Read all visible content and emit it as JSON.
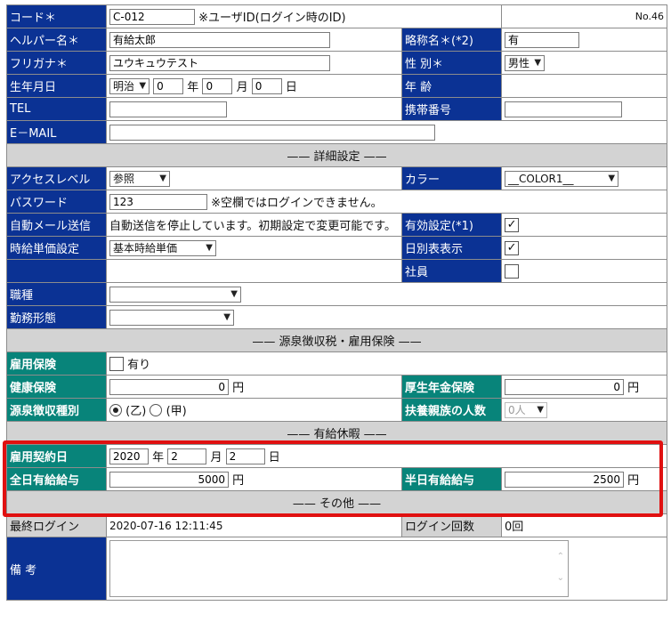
{
  "number_label": "No.46",
  "basic": {
    "code_label": "コード＊",
    "code_value": "C-012",
    "code_note": "※ユーザID(ログイン時のID)",
    "helper_label": "ヘルパー名＊",
    "helper_value": "有給太郎",
    "abbr_label": "略称名＊(*2)",
    "abbr_value": "有",
    "kana_label": "フリガナ＊",
    "kana_value": "ユウキュウテスト",
    "gender_label": "性 別＊",
    "gender_value": "男性",
    "birth_label": "生年月日",
    "era_value": "明治",
    "year_value": "0",
    "year_unit": "年",
    "month_value": "0",
    "month_unit": "月",
    "day_value": "0",
    "day_unit": "日",
    "age_label": "年 齢",
    "tel_label": "TEL",
    "mobile_label": "携帯番号",
    "email_label": "E－MAIL"
  },
  "detail": {
    "header": "—— 詳細設定 ——",
    "access_label": "アクセスレベル",
    "access_value": "参照",
    "color_label": "カラー",
    "color_value": "__COLOR1__",
    "password_label": "パスワード",
    "password_value": "123",
    "password_note": "※空欄ではログインできません。",
    "automail_label": "自動メール送信",
    "automail_value": "自動送信を停止しています。初期設定で変更可能です。",
    "valid_label": "有効設定(*1)",
    "hourly_label": "時給単価設定",
    "hourly_value": "基本時給単価",
    "daily_label": "日別表表示",
    "employee_label": "社員",
    "job_label": "職種",
    "worktype_label": "勤務形態"
  },
  "tax": {
    "header": "—— 源泉徴収税・雇用保険 ——",
    "employment_ins_label": "雇用保険",
    "employment_ins_option": "有り",
    "health_ins_label": "健康保険",
    "health_ins_value": "0",
    "yen": "円",
    "pension_label": "厚生年金保険",
    "pension_value": "0",
    "withholding_label": "源泉徴収種別",
    "withholding_opt1": "(乙)",
    "withholding_opt2": "(甲)",
    "dependents_label": "扶養親族の人数",
    "dependents_value": "0人"
  },
  "leave": {
    "header": "—— 有給休暇 ——",
    "contract_label": "雇用契約日",
    "contract_year": "2020",
    "year_unit": "年",
    "contract_month": "2",
    "month_unit": "月",
    "contract_day": "2",
    "day_unit": "日",
    "full_pay_label": "全日有給給与",
    "full_pay_value": "5000",
    "half_pay_label": "半日有給給与",
    "half_pay_value": "2500",
    "yen": "円"
  },
  "other": {
    "header": "—— その他 ——",
    "last_login_label": "最終ログイン",
    "last_login_value": "2020-07-16 12:11:45",
    "login_count_label": "ログイン回数",
    "login_count_value": "0回",
    "remarks_label": "備 考"
  },
  "colors": {
    "label_blue": "#0b3294",
    "label_teal": "#08847a",
    "section_gray": "#d3d3d3",
    "highlight_red": "#e01010"
  }
}
